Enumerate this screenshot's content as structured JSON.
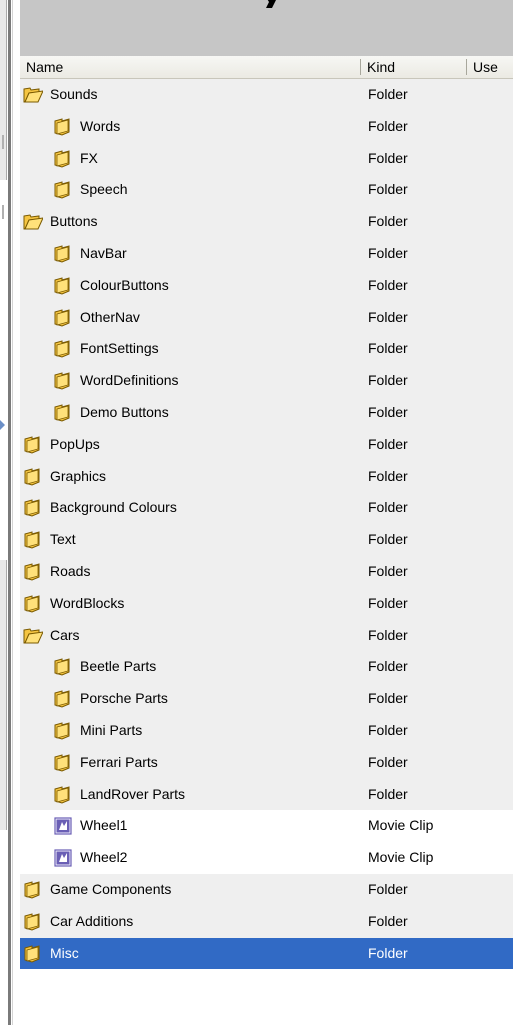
{
  "columns": {
    "name": "Name",
    "kind": "Kind",
    "use": "Use"
  },
  "rows": [
    {
      "name": "Sounds",
      "kind": "Folder",
      "level": 0,
      "icon": "open-folder-icon",
      "state": "folder"
    },
    {
      "name": "Words",
      "kind": "Folder",
      "level": 1,
      "icon": "folder-icon",
      "state": "folder"
    },
    {
      "name": "FX",
      "kind": "Folder",
      "level": 1,
      "icon": "folder-icon",
      "state": "folder"
    },
    {
      "name": "Speech",
      "kind": "Folder",
      "level": 1,
      "icon": "folder-icon",
      "state": "folder"
    },
    {
      "name": "Buttons",
      "kind": "Folder",
      "level": 0,
      "icon": "open-folder-icon",
      "state": "folder"
    },
    {
      "name": "NavBar",
      "kind": "Folder",
      "level": 1,
      "icon": "folder-icon",
      "state": "folder"
    },
    {
      "name": "ColourButtons",
      "kind": "Folder",
      "level": 1,
      "icon": "folder-icon",
      "state": "folder"
    },
    {
      "name": "OtherNav",
      "kind": "Folder",
      "level": 1,
      "icon": "folder-icon",
      "state": "folder"
    },
    {
      "name": "FontSettings",
      "kind": "Folder",
      "level": 1,
      "icon": "folder-icon",
      "state": "folder"
    },
    {
      "name": "WordDefinitions",
      "kind": "Folder",
      "level": 1,
      "icon": "folder-icon",
      "state": "folder"
    },
    {
      "name": "Demo Buttons",
      "kind": "Folder",
      "level": 1,
      "icon": "folder-icon",
      "state": "folder"
    },
    {
      "name": "PopUps",
      "kind": "Folder",
      "level": 0,
      "icon": "folder-icon",
      "state": "folder"
    },
    {
      "name": "Graphics",
      "kind": "Folder",
      "level": 0,
      "icon": "folder-icon",
      "state": "folder"
    },
    {
      "name": "Background Colours",
      "kind": "Folder",
      "level": 0,
      "icon": "folder-icon",
      "state": "folder"
    },
    {
      "name": "Text",
      "kind": "Folder",
      "level": 0,
      "icon": "folder-icon",
      "state": "folder"
    },
    {
      "name": "Roads",
      "kind": "Folder",
      "level": 0,
      "icon": "folder-icon",
      "state": "folder"
    },
    {
      "name": "WordBlocks",
      "kind": "Folder",
      "level": 0,
      "icon": "folder-icon",
      "state": "folder"
    },
    {
      "name": "Cars",
      "kind": "Folder",
      "level": 0,
      "icon": "open-folder-icon",
      "state": "folder"
    },
    {
      "name": "Beetle Parts",
      "kind": "Folder",
      "level": 1,
      "icon": "folder-icon",
      "state": "folder"
    },
    {
      "name": "Porsche Parts",
      "kind": "Folder",
      "level": 1,
      "icon": "folder-icon",
      "state": "folder"
    },
    {
      "name": "Mini Parts",
      "kind": "Folder",
      "level": 1,
      "icon": "folder-icon",
      "state": "folder"
    },
    {
      "name": "Ferrari Parts",
      "kind": "Folder",
      "level": 1,
      "icon": "folder-icon",
      "state": "folder"
    },
    {
      "name": "LandRover Parts",
      "kind": "Folder",
      "level": 1,
      "icon": "folder-icon",
      "state": "folder"
    },
    {
      "name": "Wheel1",
      "kind": "Movie Clip",
      "level": 1,
      "icon": "movie-clip-icon",
      "state": "clip"
    },
    {
      "name": "Wheel2",
      "kind": "Movie Clip",
      "level": 1,
      "icon": "movie-clip-icon",
      "state": "clip"
    },
    {
      "name": "Game Components",
      "kind": "Folder",
      "level": 0,
      "icon": "folder-icon",
      "state": "folder"
    },
    {
      "name": "Car Additions",
      "kind": "Folder",
      "level": 0,
      "icon": "folder-icon",
      "state": "folder"
    },
    {
      "name": "Misc",
      "kind": "Folder",
      "level": 0,
      "icon": "folder-icon",
      "state": "selected"
    }
  ],
  "colors": {
    "folder_fill": "#f5c542",
    "folder_stroke": "#7a5a00",
    "selection": "#316ac5",
    "clip_fill": "#6a5fb5"
  }
}
